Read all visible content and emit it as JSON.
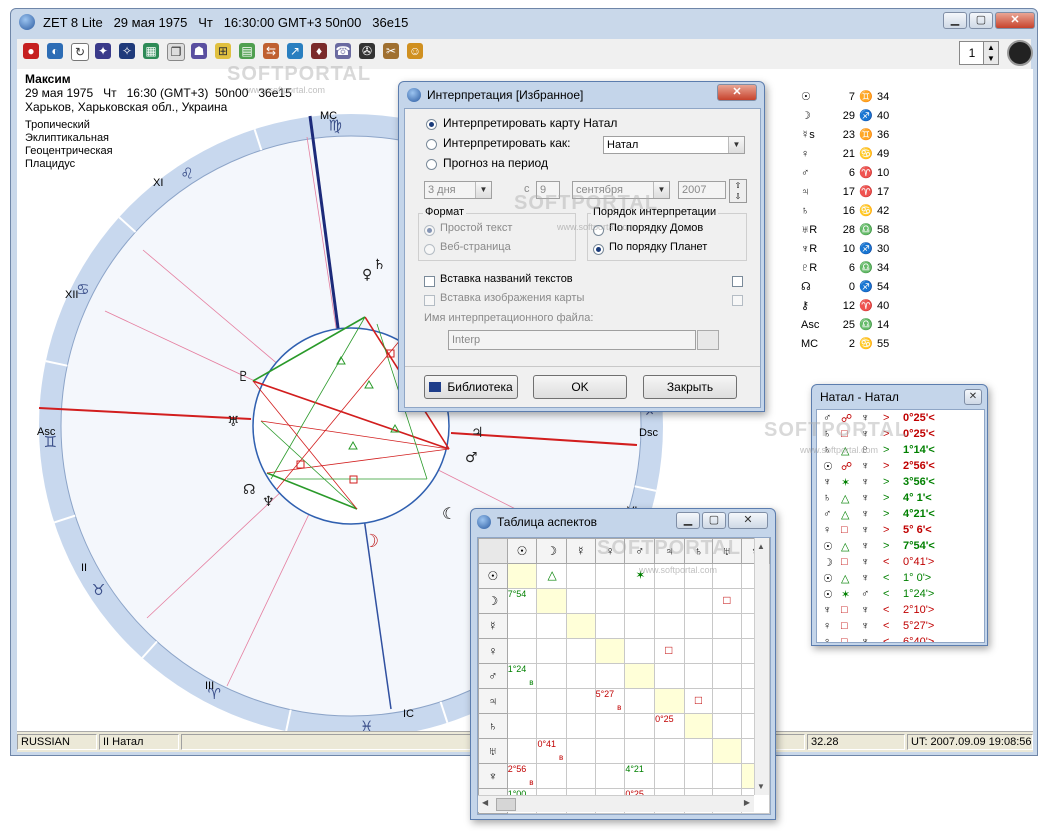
{
  "main": {
    "app_title": "ZET 8 Lite",
    "title_date": "29 мая 1975",
    "title_day": "Чт",
    "title_time": "16:30:00 GMT+3 50n00",
    "title_lon": "36e15",
    "page_number": "1",
    "person_name": "Максим",
    "person_dt": "29 мая 1975   Чт   16:30 (GMT+3)  50n00   36e15",
    "person_place": "Харьков, Харьковская обл., Украина",
    "settings": [
      "Тропический",
      "Эклиптикальная",
      "Геоцентрическая",
      "Плацидус"
    ],
    "chart_labels": {
      "mc": "MC",
      "ic": "IC",
      "asc": "Asc",
      "dsc": "Dsc",
      "h11": "XI",
      "h12": "XII",
      "h2": "II",
      "h3": "III",
      "h6": "VI"
    },
    "ring_signs": [
      "♌",
      "♍",
      "♎",
      "♏",
      "♐",
      "♑",
      "♒",
      "♓",
      "♈",
      "♉",
      "♊",
      "♋"
    ],
    "planet_list": [
      {
        "g": "☉",
        "deg": "7",
        "sign": "♊",
        "min": "34"
      },
      {
        "g": "☽",
        "deg": "29",
        "sign": "♐",
        "min": "40"
      },
      {
        "g": "☿s",
        "deg": "23",
        "sign": "♊",
        "min": "36"
      },
      {
        "g": "♀",
        "deg": "21",
        "sign": "♋",
        "min": "49"
      },
      {
        "g": "♂",
        "deg": "6",
        "sign": "♈",
        "min": "10"
      },
      {
        "g": "♃",
        "deg": "17",
        "sign": "♈",
        "min": "17"
      },
      {
        "g": "♄",
        "deg": "16",
        "sign": "♋",
        "min": "42"
      },
      {
        "g": "♅R",
        "deg": "28",
        "sign": "♎",
        "min": "58"
      },
      {
        "g": "♆R",
        "deg": "10",
        "sign": "♐",
        "min": "30"
      },
      {
        "g": "♇R",
        "deg": "6",
        "sign": "♎",
        "min": "34"
      },
      {
        "g": "☊",
        "deg": "0",
        "sign": "♐",
        "min": "54"
      },
      {
        "g": "⚷",
        "deg": "12",
        "sign": "♈",
        "min": "40"
      },
      {
        "g": "Asc",
        "deg": "25",
        "sign": "♎",
        "min": "14"
      },
      {
        "g": "MC",
        "deg": "2",
        "sign": "♋",
        "min": "55"
      }
    ],
    "status": {
      "language": "RUSSIAN",
      "chart": "II Натал",
      "value": "32.28",
      "ut": "UT: 2007.09.09 19:08:56"
    },
    "toolbar_icons": [
      "stop-icon",
      "globe-icon",
      "refresh-icon",
      "stars-icon",
      "chart-icon",
      "copy-icon",
      "people-icon",
      "grid-icon",
      "table-icon",
      "transit-icon",
      "cards-icon",
      "phone-icon",
      "compass-icon",
      "tools-icon",
      "person-icon"
    ]
  },
  "interp": {
    "title": "Интерпретация  [Избранное]",
    "opt1": "Интерпретировать карту Натал",
    "opt2": "Интерпретировать как:",
    "opt2_value": "Натал",
    "opt3": "Прогноз на период",
    "period": "3 дня",
    "from_label": "с",
    "from_day": "9",
    "from_month": "сентября",
    "from_year": "2007",
    "format_label": "Формат",
    "format_plain": "Простой текст",
    "format_web": "Веб-страница",
    "order_label": "Порядок интерпретации",
    "order_houses": "По порядку Домов",
    "order_planets": "По порядку Планет",
    "chk_titles": "Вставка названий текстов",
    "chk_image": "Вставка изображения карты",
    "file_label": "Имя интерпретационного файла:",
    "file_value": "Interp",
    "btn_library": "Библиотека",
    "btn_ok": "OK",
    "btn_close": "Закрыть"
  },
  "natal_natal": {
    "title": "Натал - Натал",
    "rows": [
      {
        "a": "♂",
        "asp": "☍",
        "b": "♆",
        "dir": ">",
        "val": "0°25'<",
        "c": "#c00000"
      },
      {
        "a": "♄",
        "asp": "□",
        "b": "♆",
        "dir": ">",
        "val": "0°25'<",
        "c": "#c00000"
      },
      {
        "a": "♄",
        "asp": "△",
        "b": "♇",
        "dir": ">",
        "val": "1°14'<",
        "c": "#008000"
      },
      {
        "a": "☉",
        "asp": "☍",
        "b": "♆",
        "dir": ">",
        "val": "2°56'<",
        "c": "#c00000"
      },
      {
        "a": "♆",
        "asp": "✶",
        "b": "♆",
        "dir": ">",
        "val": "3°56'<",
        "c": "#008000"
      },
      {
        "a": "♄",
        "asp": "△",
        "b": "♆",
        "dir": ">",
        "val": "4° 1'<",
        "c": "#008000"
      },
      {
        "a": "♂",
        "asp": "△",
        "b": "♆",
        "dir": ">",
        "val": "4°21'<",
        "c": "#008000"
      },
      {
        "a": "♀",
        "asp": "□",
        "b": "♆",
        "dir": ">",
        "val": "5° 6'<",
        "c": "#c00000"
      },
      {
        "a": "☉",
        "asp": "△",
        "b": "♆",
        "dir": ">",
        "val": "7°54'<",
        "c": "#008000"
      },
      {
        "a": "☽",
        "asp": "□",
        "b": "♆",
        "dir": "<",
        "val": "0°41'>",
        "c": "#c00000"
      },
      {
        "a": "☉",
        "asp": "△",
        "b": "♆",
        "dir": "<",
        "val": "1° 0'>",
        "c": "#008000"
      },
      {
        "a": "☉",
        "asp": "✶",
        "b": "♂",
        "dir": "<",
        "val": "1°24'>",
        "c": "#008000"
      },
      {
        "a": "♆",
        "asp": "□",
        "b": "♆",
        "dir": "<",
        "val": "2°10'>",
        "c": "#c00000"
      },
      {
        "a": "♀",
        "asp": "□",
        "b": "♆",
        "dir": "<",
        "val": "5°27'>",
        "c": "#c00000"
      },
      {
        "a": "♀",
        "asp": "□",
        "b": "♆",
        "dir": "<",
        "val": "6°40'>",
        "c": "#c00000"
      }
    ]
  },
  "aspects": {
    "title": "Таблица аспектов",
    "cols": [
      "☉",
      "☽",
      "☿",
      "♀",
      "♂",
      "♃",
      "♄",
      "♅",
      "♆"
    ],
    "rows": [
      "☉",
      "☽",
      "☿",
      "♀",
      "♂",
      "♃",
      "♄",
      "♅",
      "♆",
      "♇"
    ],
    "cells": [
      {
        "r": 0,
        "c": 1,
        "sym": "△",
        "color": "#008000"
      },
      {
        "r": 0,
        "c": 4,
        "sym": "✶",
        "color": "#008000"
      },
      {
        "r": 1,
        "c": 0,
        "txt": "7°54",
        "color": "#008000"
      },
      {
        "r": 1,
        "c": 7,
        "sym": "□",
        "color": "#c00000"
      },
      {
        "r": 3,
        "c": 5,
        "sym": "□",
        "color": "#c00000"
      },
      {
        "r": 4,
        "c": 0,
        "txt": "1°24",
        "color": "#008000",
        "sub": "в"
      },
      {
        "r": 5,
        "c": 3,
        "txt": "5°27",
        "color": "#c00000",
        "sub": "в"
      },
      {
        "r": 5,
        "c": 6,
        "sym": "□",
        "color": "#c00000"
      },
      {
        "r": 6,
        "c": 5,
        "txt": "0°25",
        "color": "#c00000"
      },
      {
        "r": 7,
        "c": 1,
        "txt": "0°41",
        "color": "#c00000",
        "sub": "в"
      },
      {
        "r": 8,
        "c": 0,
        "txt": "2°56",
        "color": "#c00000",
        "sub": "в"
      },
      {
        "r": 8,
        "c": 4,
        "txt": "4°21",
        "color": "#008000"
      },
      {
        "r": 9,
        "c": 0,
        "txt": "1°00",
        "color": "#008000",
        "sub": "в"
      },
      {
        "r": 9,
        "c": 4,
        "txt": "0°25",
        "color": "#c00000"
      }
    ]
  },
  "watermark": {
    "text": "SOFTPORTAL",
    "url": "www.softportal.com"
  }
}
